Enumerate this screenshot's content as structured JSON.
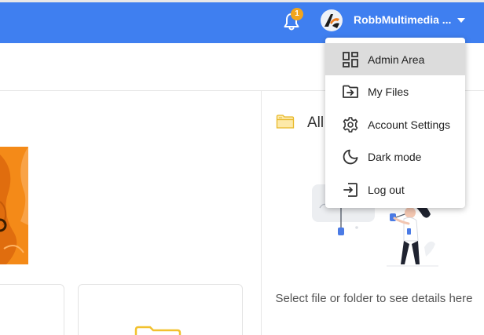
{
  "header": {
    "notification_count": "1",
    "username": "RobbMultimedia ...",
    "icons": {
      "notifications": "bell-icon",
      "account_menu": "caret-down-icon"
    },
    "colors": {
      "primary": "#3f7ff0",
      "badge": "#f2a51c"
    }
  },
  "details_panel": {
    "title": "All",
    "folder_icon": "folder-outline-icon",
    "empty_hint": "Select file or folder to see details here"
  },
  "user_menu": {
    "items": [
      {
        "label": "Admin Area",
        "icon": "dashboard-icon",
        "active": true
      },
      {
        "label": "My Files",
        "icon": "folder-arrow-icon",
        "active": false
      },
      {
        "label": "Account Settings",
        "icon": "gear-icon",
        "active": false
      },
      {
        "label": "Dark mode",
        "icon": "moon-icon",
        "active": false
      },
      {
        "label": "Log out",
        "icon": "logout-icon",
        "active": false
      }
    ]
  }
}
